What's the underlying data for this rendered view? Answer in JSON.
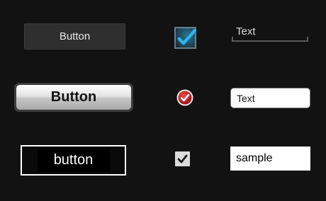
{
  "row1": {
    "button_label": "Button",
    "text_field_value": "Text"
  },
  "row2": {
    "button_label": "Button",
    "text_field_value": "Text"
  },
  "row3": {
    "button_label": "button",
    "text_field_value": "sample"
  },
  "checkboxes": {
    "holo_checked": true,
    "red_checked": true,
    "gray_checked": true
  },
  "icons": {
    "holo_check": "check-icon",
    "red_check": "check-circle-icon",
    "gray_check": "check-icon"
  },
  "colors": {
    "background": "#121212",
    "holo_accent": "#33b5e5",
    "red_accent": "#c8141e"
  }
}
